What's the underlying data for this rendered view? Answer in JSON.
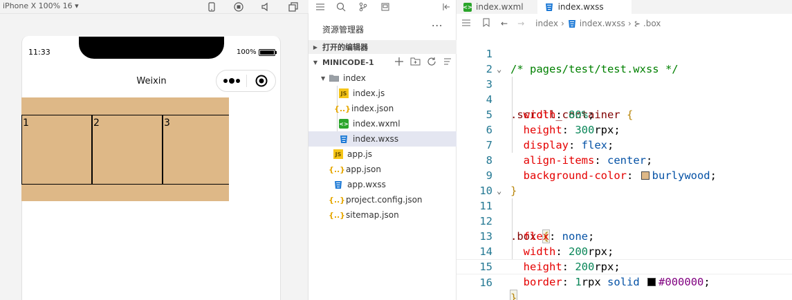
{
  "simulator": {
    "device_label": "iPhone X 100% 16 ▾",
    "status_time": "11:33",
    "battery_percent": "100%",
    "nav_title": "Weixin",
    "boxes": [
      "1",
      "2",
      "3"
    ],
    "container_color": "#deb887"
  },
  "explorer": {
    "title": "资源管理器",
    "more": "···",
    "open_editors_label": "打开的编辑器",
    "project_label": "MINICODE-1",
    "tree": [
      {
        "label": "index",
        "type": "folder",
        "icon": "folder-icon"
      },
      {
        "label": "index.js",
        "type": "js",
        "icon": "js-file-icon"
      },
      {
        "label": "index.json",
        "type": "json",
        "icon": "json-file-icon"
      },
      {
        "label": "index.wxml",
        "type": "wxml",
        "icon": "wxml-file-icon"
      },
      {
        "label": "index.wxss",
        "type": "wxss",
        "icon": "wxss-file-icon",
        "selected": true
      },
      {
        "label": "app.js",
        "type": "js",
        "icon": "js-file-icon"
      },
      {
        "label": "app.json",
        "type": "json",
        "icon": "json-file-icon"
      },
      {
        "label": "app.wxss",
        "type": "wxss",
        "icon": "wxss-file-icon"
      },
      {
        "label": "project.config.json",
        "type": "json",
        "icon": "json-file-icon"
      },
      {
        "label": "sitemap.json",
        "type": "json",
        "icon": "json-file-icon"
      }
    ]
  },
  "editor": {
    "tabs": [
      {
        "label": "index.wxml",
        "active": false,
        "icon": "wxml-file-icon"
      },
      {
        "label": "index.wxss",
        "active": true,
        "icon": "wxss-file-icon"
      }
    ],
    "breadcrumb": [
      "index",
      "index.wxss",
      ".box"
    ],
    "lines": [
      {
        "n": "1",
        "text": "/* pages/test/test.wxss */"
      },
      {
        "n": "2",
        "text": ""
      },
      {
        "n": "3",
        "text": ".scroll_container {"
      },
      {
        "n": "4",
        "text": "  width: 80%;"
      },
      {
        "n": "5",
        "text": "  height: 300rpx;"
      },
      {
        "n": "6",
        "text": "  display: flex;"
      },
      {
        "n": "7",
        "text": "  align-items: center;"
      },
      {
        "n": "8",
        "text": "  background-color: burlywood;"
      },
      {
        "n": "9",
        "text": "}"
      },
      {
        "n": "10",
        "text": ""
      },
      {
        "n": "11",
        "text": ".box {"
      },
      {
        "n": "12",
        "text": "  flex: none;"
      },
      {
        "n": "13",
        "text": "  width: 200rpx;"
      },
      {
        "n": "14",
        "text": "  height: 200rpx;"
      },
      {
        "n": "15",
        "text": "  border: 1rpx solid #000000;"
      },
      {
        "n": "16",
        "text": "}"
      }
    ],
    "swatch_colors": {
      "burlywood": "#deb887",
      "black": "#000000"
    }
  }
}
